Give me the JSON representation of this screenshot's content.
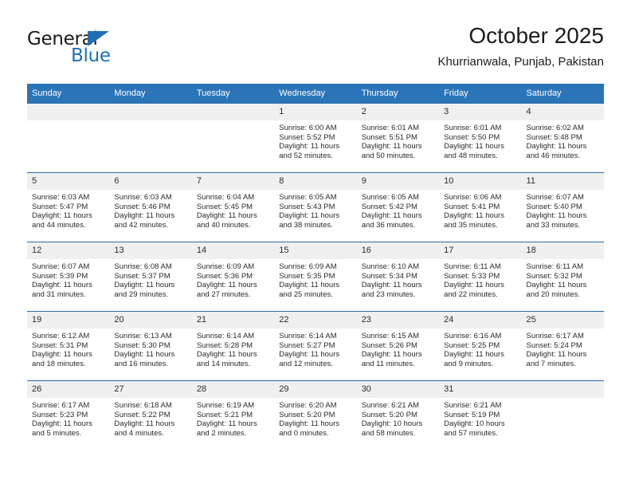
{
  "brand": {
    "name_part1": "General",
    "name_part2": "Blue",
    "triangle_color": "#1f6eb4"
  },
  "header": {
    "title": "October 2025",
    "subtitle": "Khurrianwala, Punjab, Pakistan"
  },
  "theme": {
    "header_bg": "#2b74b8",
    "grid_line": "#2b6ca8",
    "daynum_bg": "#f0f0f0"
  },
  "weekdays": [
    "Sunday",
    "Monday",
    "Tuesday",
    "Wednesday",
    "Thursday",
    "Friday",
    "Saturday"
  ],
  "weeks": [
    [
      {
        "day": "",
        "empty": true,
        "lines": []
      },
      {
        "day": "",
        "empty": true,
        "lines": []
      },
      {
        "day": "",
        "empty": true,
        "lines": []
      },
      {
        "day": "1",
        "empty": false,
        "lines": [
          "Sunrise: 6:00 AM",
          "Sunset: 5:52 PM",
          "Daylight: 11 hours",
          "and 52 minutes."
        ]
      },
      {
        "day": "2",
        "empty": false,
        "lines": [
          "Sunrise: 6:01 AM",
          "Sunset: 5:51 PM",
          "Daylight: 11 hours",
          "and 50 minutes."
        ]
      },
      {
        "day": "3",
        "empty": false,
        "lines": [
          "Sunrise: 6:01 AM",
          "Sunset: 5:50 PM",
          "Daylight: 11 hours",
          "and 48 minutes."
        ]
      },
      {
        "day": "4",
        "empty": false,
        "lines": [
          "Sunrise: 6:02 AM",
          "Sunset: 5:48 PM",
          "Daylight: 11 hours",
          "and 46 minutes."
        ]
      }
    ],
    [
      {
        "day": "5",
        "empty": false,
        "lines": [
          "Sunrise: 6:03 AM",
          "Sunset: 5:47 PM",
          "Daylight: 11 hours",
          "and 44 minutes."
        ]
      },
      {
        "day": "6",
        "empty": false,
        "lines": [
          "Sunrise: 6:03 AM",
          "Sunset: 5:46 PM",
          "Daylight: 11 hours",
          "and 42 minutes."
        ]
      },
      {
        "day": "7",
        "empty": false,
        "lines": [
          "Sunrise: 6:04 AM",
          "Sunset: 5:45 PM",
          "Daylight: 11 hours",
          "and 40 minutes."
        ]
      },
      {
        "day": "8",
        "empty": false,
        "lines": [
          "Sunrise: 6:05 AM",
          "Sunset: 5:43 PM",
          "Daylight: 11 hours",
          "and 38 minutes."
        ]
      },
      {
        "day": "9",
        "empty": false,
        "lines": [
          "Sunrise: 6:05 AM",
          "Sunset: 5:42 PM",
          "Daylight: 11 hours",
          "and 36 minutes."
        ]
      },
      {
        "day": "10",
        "empty": false,
        "lines": [
          "Sunrise: 6:06 AM",
          "Sunset: 5:41 PM",
          "Daylight: 11 hours",
          "and 35 minutes."
        ]
      },
      {
        "day": "11",
        "empty": false,
        "lines": [
          "Sunrise: 6:07 AM",
          "Sunset: 5:40 PM",
          "Daylight: 11 hours",
          "and 33 minutes."
        ]
      }
    ],
    [
      {
        "day": "12",
        "empty": false,
        "lines": [
          "Sunrise: 6:07 AM",
          "Sunset: 5:39 PM",
          "Daylight: 11 hours",
          "and 31 minutes."
        ]
      },
      {
        "day": "13",
        "empty": false,
        "lines": [
          "Sunrise: 6:08 AM",
          "Sunset: 5:37 PM",
          "Daylight: 11 hours",
          "and 29 minutes."
        ]
      },
      {
        "day": "14",
        "empty": false,
        "lines": [
          "Sunrise: 6:09 AM",
          "Sunset: 5:36 PM",
          "Daylight: 11 hours",
          "and 27 minutes."
        ]
      },
      {
        "day": "15",
        "empty": false,
        "lines": [
          "Sunrise: 6:09 AM",
          "Sunset: 5:35 PM",
          "Daylight: 11 hours",
          "and 25 minutes."
        ]
      },
      {
        "day": "16",
        "empty": false,
        "lines": [
          "Sunrise: 6:10 AM",
          "Sunset: 5:34 PM",
          "Daylight: 11 hours",
          "and 23 minutes."
        ]
      },
      {
        "day": "17",
        "empty": false,
        "lines": [
          "Sunrise: 6:11 AM",
          "Sunset: 5:33 PM",
          "Daylight: 11 hours",
          "and 22 minutes."
        ]
      },
      {
        "day": "18",
        "empty": false,
        "lines": [
          "Sunrise: 6:11 AM",
          "Sunset: 5:32 PM",
          "Daylight: 11 hours",
          "and 20 minutes."
        ]
      }
    ],
    [
      {
        "day": "19",
        "empty": false,
        "lines": [
          "Sunrise: 6:12 AM",
          "Sunset: 5:31 PM",
          "Daylight: 11 hours",
          "and 18 minutes."
        ]
      },
      {
        "day": "20",
        "empty": false,
        "lines": [
          "Sunrise: 6:13 AM",
          "Sunset: 5:30 PM",
          "Daylight: 11 hours",
          "and 16 minutes."
        ]
      },
      {
        "day": "21",
        "empty": false,
        "lines": [
          "Sunrise: 6:14 AM",
          "Sunset: 5:28 PM",
          "Daylight: 11 hours",
          "and 14 minutes."
        ]
      },
      {
        "day": "22",
        "empty": false,
        "lines": [
          "Sunrise: 6:14 AM",
          "Sunset: 5:27 PM",
          "Daylight: 11 hours",
          "and 12 minutes."
        ]
      },
      {
        "day": "23",
        "empty": false,
        "lines": [
          "Sunrise: 6:15 AM",
          "Sunset: 5:26 PM",
          "Daylight: 11 hours",
          "and 11 minutes."
        ]
      },
      {
        "day": "24",
        "empty": false,
        "lines": [
          "Sunrise: 6:16 AM",
          "Sunset: 5:25 PM",
          "Daylight: 11 hours",
          "and 9 minutes."
        ]
      },
      {
        "day": "25",
        "empty": false,
        "lines": [
          "Sunrise: 6:17 AM",
          "Sunset: 5:24 PM",
          "Daylight: 11 hours",
          "and 7 minutes."
        ]
      }
    ],
    [
      {
        "day": "26",
        "empty": false,
        "lines": [
          "Sunrise: 6:17 AM",
          "Sunset: 5:23 PM",
          "Daylight: 11 hours",
          "and 5 minutes."
        ]
      },
      {
        "day": "27",
        "empty": false,
        "lines": [
          "Sunrise: 6:18 AM",
          "Sunset: 5:22 PM",
          "Daylight: 11 hours",
          "and 4 minutes."
        ]
      },
      {
        "day": "28",
        "empty": false,
        "lines": [
          "Sunrise: 6:19 AM",
          "Sunset: 5:21 PM",
          "Daylight: 11 hours",
          "and 2 minutes."
        ]
      },
      {
        "day": "29",
        "empty": false,
        "lines": [
          "Sunrise: 6:20 AM",
          "Sunset: 5:20 PM",
          "Daylight: 11 hours",
          "and 0 minutes."
        ]
      },
      {
        "day": "30",
        "empty": false,
        "lines": [
          "Sunrise: 6:21 AM",
          "Sunset: 5:20 PM",
          "Daylight: 10 hours",
          "and 58 minutes."
        ]
      },
      {
        "day": "31",
        "empty": false,
        "lines": [
          "Sunrise: 6:21 AM",
          "Sunset: 5:19 PM",
          "Daylight: 10 hours",
          "and 57 minutes."
        ]
      },
      {
        "day": "",
        "empty": true,
        "lines": []
      }
    ]
  ]
}
